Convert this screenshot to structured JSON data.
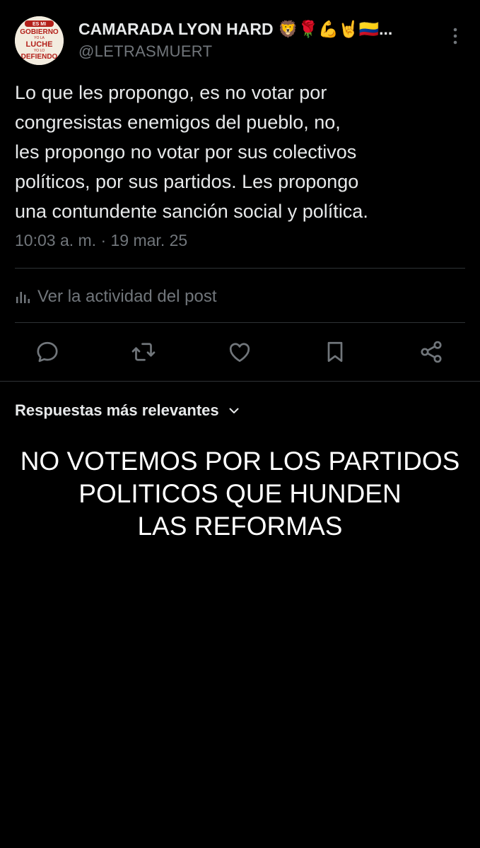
{
  "author": {
    "display_name": "CAMARADA LYON HARD 🦁🌹💪🤘🇨🇴...",
    "handle": "@LETRASMUERT",
    "avatar_text": [
      "ES MI",
      "GOBIERNO",
      "YO LA",
      "LUCHE",
      "YO LO",
      "DEFIENDO"
    ]
  },
  "post": {
    "text": "Lo que les propongo, es no votar por\ncongresistas enemigos del pueblo, no,\nles propongo no votar por sus colectivos\npolíticos, por sus partidos. Les propongo\nuna contundente sanción social y política.",
    "timestamp": "10:03 a. m. · 19 mar. 25"
  },
  "activity": {
    "label": "Ver la actividad del post",
    "icon": "bar-chart-icon"
  },
  "actions": [
    {
      "name": "reply",
      "icon": "reply-icon"
    },
    {
      "name": "repost",
      "icon": "repost-icon"
    },
    {
      "name": "like",
      "icon": "heart-icon"
    },
    {
      "name": "bookmark",
      "icon": "bookmark-icon"
    },
    {
      "name": "share",
      "icon": "share-icon"
    }
  ],
  "replies": {
    "sort_label": "Respuestas más relevantes"
  },
  "image_text": {
    "lines": [
      "NO VOTEMOS POR LOS PARTIDOS",
      "POLITICOS QUE HUNDEN",
      "LAS REFORMAS"
    ]
  },
  "colors": {
    "background": "#000000",
    "text_primary": "#e7e9ea",
    "text_secondary": "#71767b",
    "divider": "#2f3336",
    "avatar_red": "#b3201a"
  }
}
